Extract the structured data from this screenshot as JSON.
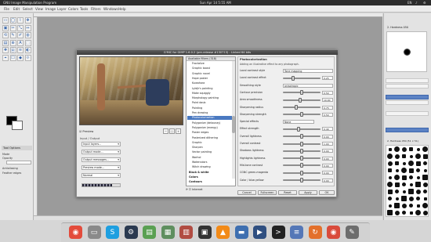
{
  "system_bar": {
    "app_name": "GNU Image Manipulation Program",
    "clock": "Sun Apr 14  5:55 AM",
    "indicators": [
      "EN",
      "♪",
      "⚙"
    ]
  },
  "menu": [
    "File",
    "Edit",
    "Select",
    "View",
    "Image",
    "Layer",
    "Colors",
    "Tools",
    "Filters",
    "Windows",
    "Help"
  ],
  "dialog": {
    "title": "G'MIC for GIMP 1.6.0.2 (pre-release #130713) - Linked 64 bits",
    "preview_label": "Preview",
    "input_output_label": "Input / Output",
    "dropdowns": [
      "Input layers...",
      "Output mode...",
      "Output messages...",
      "Preview mode...",
      "Normal"
    ],
    "progress": 0.8,
    "filter_list_header": "Available filters (318)",
    "filters": [
      {
        "label": "Fractalize",
        "kind": "item"
      },
      {
        "label": "Graphic boost",
        "kind": "item"
      },
      {
        "label": "Graphic novel",
        "kind": "item"
      },
      {
        "label": "Hope poster",
        "kind": "item"
      },
      {
        "label": "Kuwahara",
        "kind": "item"
      },
      {
        "label": "Lylejk's painting",
        "kind": "item"
      },
      {
        "label": "Make squiggly",
        "kind": "item"
      },
      {
        "label": "Morphology painting",
        "kind": "item"
      },
      {
        "label": "Paint daub",
        "kind": "item"
      },
      {
        "label": "Painting",
        "kind": "item"
      },
      {
        "label": "Pen drawing",
        "kind": "item"
      },
      {
        "label": "Photocolorization",
        "kind": "selected"
      },
      {
        "label": "Polygonize (delaunay)",
        "kind": "item"
      },
      {
        "label": "Polygonize (energy)",
        "kind": "item"
      },
      {
        "label": "Poster edges",
        "kind": "item"
      },
      {
        "label": "Posterized dithering",
        "kind": "item"
      },
      {
        "label": "Graphic",
        "kind": "item"
      },
      {
        "label": "Sharpen",
        "kind": "item"
      },
      {
        "label": "Vector painting",
        "kind": "item"
      },
      {
        "label": "Warhol",
        "kind": "item"
      },
      {
        "label": "Watercolors",
        "kind": "item"
      },
      {
        "label": "Witch drawing",
        "kind": "item"
      },
      {
        "label": "Black & white",
        "kind": "category"
      },
      {
        "label": "Colors",
        "kind": "category"
      },
      {
        "label": "Contours",
        "kind": "category"
      }
    ],
    "snapshot_label": "Internet",
    "settings": {
      "title": "Photocolorization",
      "description": "Adding an illustrative effect to any photograph.",
      "rows": [
        {
          "label": "Local contrast style",
          "type": "combo",
          "value": "Tone mapping"
        },
        {
          "label": "Local contrast effect",
          "type": "slider",
          "value": "0.25",
          "pos": 0.25
        },
        {
          "label": "Smoothing style",
          "type": "combo",
          "value": "anisotropic"
        },
        {
          "label": "Contour precision",
          "type": "slider",
          "value": "0.50",
          "pos": 0.5
        },
        {
          "label": "Area smoothness",
          "type": "slider",
          "value": "10.00",
          "pos": 0.45
        },
        {
          "label": "Sharpening radius",
          "type": "slider",
          "value": "0.75",
          "pos": 0.35
        },
        {
          "label": "Sharpening strength",
          "type": "slider",
          "value": "0.50",
          "pos": 0.5
        },
        {
          "label": "Special effects",
          "type": "combo_short",
          "value": "None"
        },
        {
          "label": "Effect strength",
          "type": "slider",
          "value": "0.40",
          "pos": 0.4
        },
        {
          "label": "Overall lightness",
          "type": "slider",
          "value": "0.00",
          "pos": 0.5
        },
        {
          "label": "Overall contrast",
          "type": "slider",
          "value": "1.00",
          "pos": 0.5
        },
        {
          "label": "Shadows lightness",
          "type": "slider",
          "value": "0.00",
          "pos": 0.5
        },
        {
          "label": "Highlights lightness",
          "type": "slider",
          "value": "0.00",
          "pos": 0.5
        },
        {
          "label": "Mid-tone contrast",
          "type": "slider",
          "value": "0.00",
          "pos": 0.5
        },
        {
          "label": "CGNC green-magenta",
          "type": "slider",
          "value": "0.00",
          "pos": 0.5
        },
        {
          "label": "Color / blue-yellow",
          "type": "slider",
          "value": "0.00",
          "pos": 0.5
        }
      ]
    },
    "buttons": [
      "Cancel",
      "Fullscreen",
      "Reset",
      "Apply",
      "OK"
    ]
  },
  "toolbox": {
    "tool_options_label": "Tool Options",
    "mode_label": "Mode",
    "opacity_label": "Opacity",
    "options": [
      "Antialiasing",
      "Feather edges"
    ]
  },
  "dock": {
    "brush_name": "2. Hardness 050",
    "brush_set": "2. Hardness 050 (51 × 51)"
  },
  "taskbar": {
    "icons": [
      {
        "name": "chrome-icon",
        "color": "#e34b3b",
        "glyph": "◉"
      },
      {
        "name": "folder-icon",
        "color": "#8a8a8a",
        "glyph": "▭"
      },
      {
        "name": "skype-icon",
        "color": "#1e9fe0",
        "glyph": "S"
      },
      {
        "name": "steam-icon",
        "color": "#2b3a50",
        "glyph": "⚙"
      },
      {
        "name": "document-icon",
        "color": "#5aa052",
        "glyph": "▤"
      },
      {
        "name": "spreadsheet-icon",
        "color": "#5f8f5f",
        "glyph": "▦"
      },
      {
        "name": "presentation-icon",
        "color": "#b14c42",
        "glyph": "▥"
      },
      {
        "name": "monitor-icon",
        "color": "#333333",
        "glyph": "▣"
      },
      {
        "name": "vlc-icon",
        "color": "#f28a17",
        "glyph": "▲"
      },
      {
        "name": "files-icon",
        "color": "#3e6fb0",
        "glyph": "▬"
      },
      {
        "name": "video-icon",
        "color": "#2f4f80",
        "glyph": "▶"
      },
      {
        "name": "terminal-icon",
        "color": "#222222",
        "glyph": ">"
      },
      {
        "name": "settings-icon",
        "color": "#5477b7",
        "glyph": "≡"
      },
      {
        "name": "sync-icon",
        "color": "#e3702b",
        "glyph": "↻"
      },
      {
        "name": "chrome-alt-icon",
        "color": "#d94b3b",
        "glyph": "◉"
      },
      {
        "name": "gimp-icon",
        "color": "#6d6d6d",
        "glyph": "✎"
      }
    ]
  }
}
